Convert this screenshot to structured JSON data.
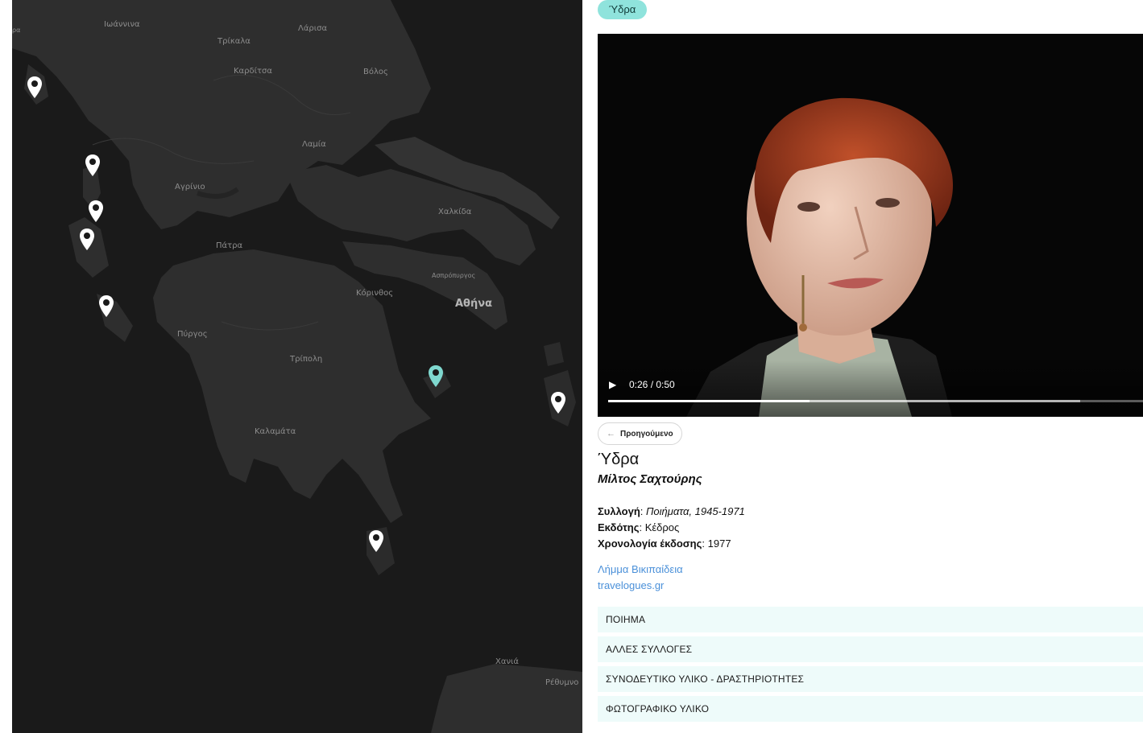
{
  "map": {
    "labels": {
      "ioannina": "Ιωάννινα",
      "larisa": "Λάρισα",
      "trikala": "Τρίκαλα",
      "karditsa": "Καρδίτσα",
      "volos": "Βόλος",
      "lamia": "Λαμία",
      "agrinio": "Αγρίνιο",
      "chalkida": "Χαλκίδα",
      "patra": "Πάτρα",
      "aspropyrgos": "Ασπρόπυργος",
      "korinthos": "Κόρινθος",
      "athina": "Αθήνα",
      "pyrgos": "Πύργος",
      "tripoli": "Τρίπολη",
      "kalamata": "Καλαμάτα",
      "chania": "Χανιά",
      "rethymno": "Ρέθυμνο",
      "edge": "ρα"
    },
    "pin_color_default": "#ffffff",
    "pin_color_active": "#7fd8cf",
    "pin_icon": "map-marker-icon"
  },
  "detail": {
    "tag": "Ύδρα",
    "video": {
      "time": "0:26 / 0:50",
      "progress": 0.376,
      "buffered": 0.883,
      "play_icon": "play-icon",
      "play_glyph": "▶"
    },
    "prev_button": {
      "arrow": "←",
      "label": "Προηγούμενο"
    },
    "title": "Ύδρα",
    "author": "Μίλτος Σαχτούρης",
    "meta": {
      "collection_label": "Συλλογή",
      "collection_value": "Ποιήματα, 1945-1971",
      "publisher_label": "Εκδότης",
      "publisher_value": "Κέδρος",
      "year_label": "Χρονολογία έκδοσης",
      "year_value": "1977"
    },
    "links": {
      "wikipedia": "Λήμμα Βικιπαίδεια",
      "travelogues": "travelogues.gr"
    },
    "accordion": [
      "ΠΟΙΗΜΑ",
      "ΑΛΛΕΣ ΣΥΛΛΟΓΕΣ",
      "ΣΥΝΟΔΕΥΤΙΚΟ ΥΛΙΚΟ - ΔΡΑΣΤΗΡΙΟΤΗΤΕΣ",
      "ΦΩΤΟΓΡΑΦΙΚΟ ΥΛΙΚΟ"
    ]
  }
}
